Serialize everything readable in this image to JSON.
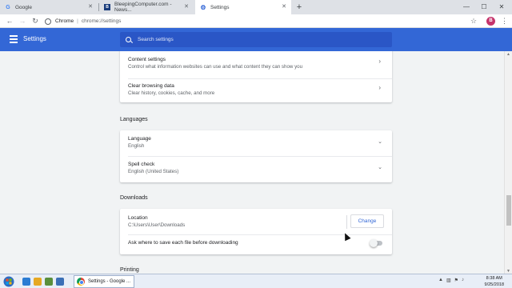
{
  "tabs": [
    {
      "label": "Google",
      "favicon": "google-favicon",
      "active": false
    },
    {
      "label": "BleepingComputer.com - News...",
      "favicon": "bleepingcomputer-favicon",
      "active": false
    },
    {
      "label": "Settings",
      "favicon": "gear-icon",
      "active": true
    }
  ],
  "window_controls": {
    "minimize": "—",
    "maximize": "☐",
    "close": "✕"
  },
  "address_bar": {
    "site_chip": "Chrome",
    "separator": "|",
    "url": "chrome://settings"
  },
  "profile": {
    "initial": "B",
    "color": "#c5346c"
  },
  "header": {
    "title": "Settings",
    "search_placeholder": "Search settings",
    "color": "#3367d6"
  },
  "privacy": {
    "rows": [
      {
        "title": "Content settings",
        "subtitle": "Control what information websites can use and what content they can show you"
      },
      {
        "title": "Clear browsing data",
        "subtitle": "Clear history, cookies, cache, and more"
      }
    ]
  },
  "languages": {
    "section_title": "Languages",
    "rows": [
      {
        "title": "Language",
        "value": "English"
      },
      {
        "title": "Spell check",
        "value": "English (United States)"
      }
    ]
  },
  "downloads": {
    "section_title": "Downloads",
    "location_label": "Location",
    "location_value": "C:\\Users\\User\\Downloads",
    "change_label": "Change",
    "ask_label": "Ask where to save each file before downloading",
    "ask_enabled": false
  },
  "next_section": {
    "title": "Printing"
  },
  "taskbar": {
    "active_task_label": "Settings - Google ...",
    "time": "8:38 AM",
    "date": "9/25/2018"
  }
}
